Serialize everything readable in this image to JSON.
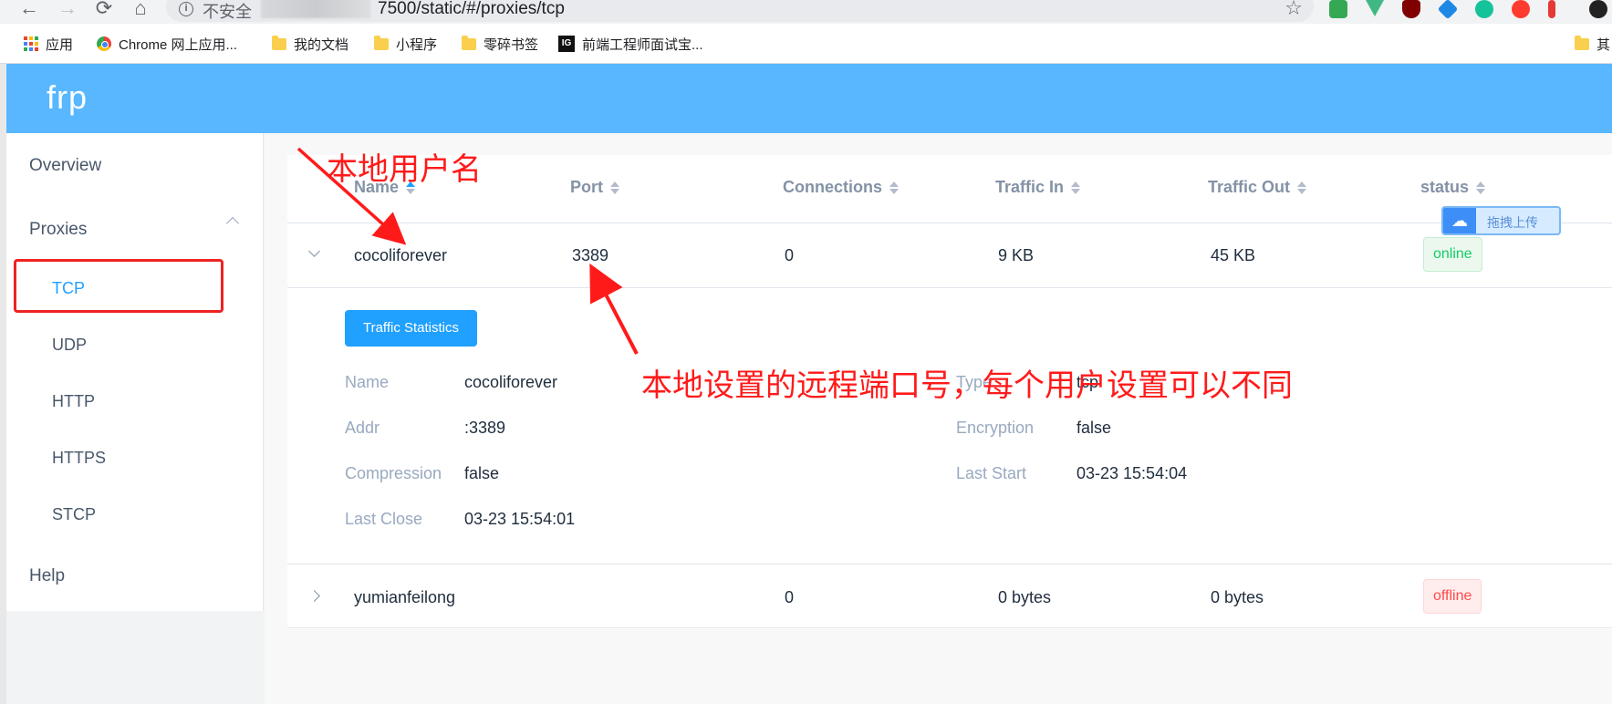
{
  "browser": {
    "nav": {
      "back": "←",
      "forward": "→",
      "reload": "⟳",
      "home": "⌂"
    },
    "omnibox": {
      "security_label": "不安全",
      "url": "7500/static/#/proxies/tcp",
      "star": "☆"
    },
    "extension_icons": [
      "qr-extension-icon",
      "vue-devtools-icon",
      "ublock-icon",
      "dev-extension-icon",
      "grammarly-icon",
      "infinity-icon",
      "pocket-icon"
    ],
    "extension_colors": [
      "#34a853",
      "#41b883",
      "#800000",
      "#1e88e5",
      "#15c39a",
      "#ff3b30",
      "#e53935"
    ],
    "bookmarks": [
      {
        "label": "应用",
        "icon": "apps-grid-icon"
      },
      {
        "label": "Chrome 网上应用...",
        "icon": "chrome-store-icon"
      },
      {
        "label": "我的文档",
        "icon": "folder-icon"
      },
      {
        "label": "小程序",
        "icon": "folder-icon"
      },
      {
        "label": "零碎书签",
        "icon": "folder-icon"
      },
      {
        "label": "前端工程师面试宝...",
        "icon": "frontend-site-icon"
      },
      {
        "label": "其",
        "icon": "folder-icon"
      }
    ]
  },
  "app": {
    "logo": "frp",
    "header_color": "#58b7ff"
  },
  "sidebar": {
    "items": [
      {
        "label": "Overview"
      },
      {
        "label": "Proxies",
        "expanded": true
      }
    ],
    "sub_items": [
      {
        "label": "TCP",
        "active": true
      },
      {
        "label": "UDP"
      },
      {
        "label": "HTTP"
      },
      {
        "label": "HTTPS"
      },
      {
        "label": "STCP"
      }
    ],
    "help": "Help"
  },
  "table": {
    "columns": [
      "Name",
      "Port",
      "Connections",
      "Traffic In",
      "Traffic Out",
      "status"
    ],
    "rows": [
      {
        "name": "cocoliforever",
        "port": "3389",
        "connections": "0",
        "traffic_in": "9 KB",
        "traffic_out": "45 KB",
        "status": "online",
        "expanded": true
      },
      {
        "name": "yumianfeilong",
        "port": "",
        "connections": "0",
        "traffic_in": "0 bytes",
        "traffic_out": "0 bytes",
        "status": "offline",
        "expanded": false
      }
    ]
  },
  "details": {
    "button": "Traffic Statistics",
    "fields": {
      "name_label": "Name",
      "name_value": "cocoliforever",
      "type_label": "Type",
      "type_value": "tcp",
      "addr_label": "Addr",
      "addr_value": ":3389",
      "encryption_label": "Encryption",
      "encryption_value": "false",
      "compression_label": "Compression",
      "compression_value": "false",
      "last_start_label": "Last Start",
      "last_start_value": "03-23 15:54:04",
      "last_close_label": "Last Close",
      "last_close_value": "03-23 15:54:01"
    }
  },
  "upload_widget": {
    "label": "拖拽上传"
  },
  "annotations": {
    "username_note": "本地用户名",
    "port_note": "本地设置的远程端口号，每个用户设置可以不同",
    "color": "#ff1a1a"
  }
}
